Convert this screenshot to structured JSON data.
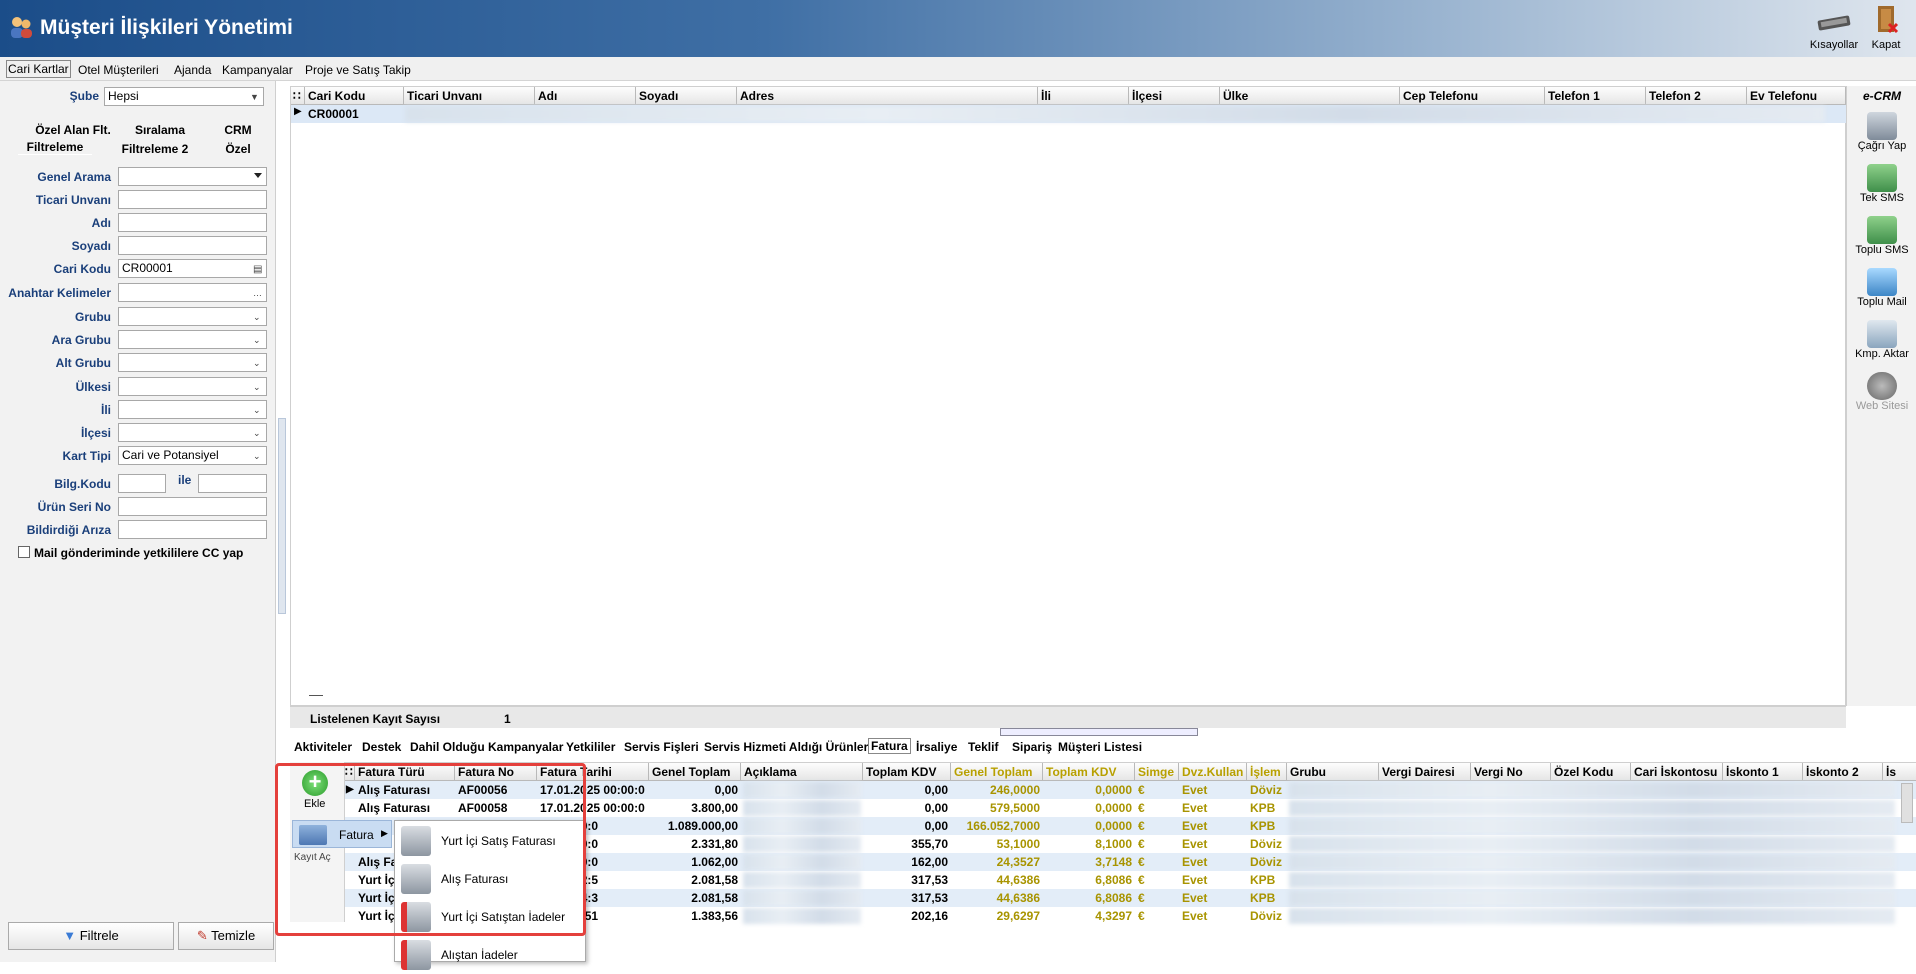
{
  "window": {
    "title": "Müşteri İlişkileri Yönetimi"
  },
  "toolbar": {
    "shortcuts_label": "Kısayollar",
    "close_label": "Kapat"
  },
  "menu": [
    "Cari Kartlar",
    "Otel Müşterileri",
    "Ajanda",
    "Kampanyalar",
    "Proje ve Satış Takip"
  ],
  "filter": {
    "sube_label": "Şube",
    "sube_value": "Hepsi",
    "tabs_row1": [
      "Özel Alan Flt.",
      "Sıralama",
      "CRM"
    ],
    "tabs_row2": [
      "Filtreleme",
      "Filtreleme 2",
      "Özel"
    ],
    "fields": [
      {
        "label": "Genel Arama",
        "value": ""
      },
      {
        "label": "Ticari Unvanı",
        "value": ""
      },
      {
        "label": "Adı",
        "value": ""
      },
      {
        "label": "Soyadı",
        "value": ""
      },
      {
        "label": "Cari Kodu",
        "value": "CR00001"
      },
      {
        "label": "Anahtar Kelimeler",
        "value": ""
      },
      {
        "label": "Grubu",
        "value": ""
      },
      {
        "label": "Ara Grubu",
        "value": ""
      },
      {
        "label": "Alt Grubu",
        "value": ""
      },
      {
        "label": "Ülkesi",
        "value": ""
      },
      {
        "label": "İli",
        "value": ""
      },
      {
        "label": "İlçesi",
        "value": ""
      },
      {
        "label": "Kart Tipi",
        "value": "Cari ve Potansiyel"
      }
    ],
    "bilg_kodu_label": "Bilg.Kodu",
    "ile_label": "ile",
    "urun_seri_label": "Ürün Seri No",
    "bildirdigi_ariza_label": "Bildirdiği Arıza",
    "mail_cc_label": "Mail gönderiminde yetkililere CC yap",
    "filter_button": "Filtrele",
    "clear_button": "Temizle"
  },
  "main_grid": {
    "columns": [
      "Cari Kodu",
      "Ticari Unvanı",
      "Adı",
      "Soyadı",
      "Adres",
      "İli",
      "İlçesi",
      "Ülke",
      "Cep Telefonu",
      "Telefon 1",
      "Telefon 2",
      "Ev Telefonu"
    ],
    "rows": [
      {
        "cari_kodu": "CR00001"
      }
    ],
    "status_label": "Listelenen Kayıt Sayısı",
    "status_count": "1"
  },
  "ecrm": {
    "title": "e-CRM",
    "buttons": [
      "Çağrı Yap",
      "Tek SMS",
      "Toplu SMS",
      "Toplu Mail",
      "Kmp. Aktar",
      "Web Sitesi"
    ]
  },
  "bottom_tabs": [
    "Aktiviteler",
    "Destek",
    "Dahil Olduğu Kampanyalar",
    "Yetkililer",
    "Servis Fişleri",
    "Servis Hizmeti Aldığı Ürünler",
    "Fatura",
    "İrsaliye",
    "Teklif",
    "Sipariş",
    "Müşteri Listesi"
  ],
  "side_actions": {
    "add_label": "Ekle",
    "records_label": "Kayıt Aç"
  },
  "invoice_grid": {
    "columns": [
      "Fatura Türü",
      "Fatura No",
      "Fatura Tarihi",
      "Genel Toplam",
      "Açıklama",
      "Toplam KDV",
      "Genel Toplam",
      "Toplam KDV",
      "Simge",
      "Dvz.Kullan",
      "İşlem",
      "Grubu",
      "Vergi Dairesi",
      "Vergi No",
      "Özel Kodu",
      "Cari İskontosu",
      "İskonto 1",
      "İskonto 2",
      "İs"
    ],
    "rows": [
      {
        "tur": "Alış Faturası",
        "no": "AF00056",
        "tarih": "17.01.2025 00:00:0",
        "genel": "0,00",
        "kdv": "0,00",
        "dgenel": "246,0000",
        "dkdv": "0,0000",
        "simge": "€",
        "dvz": "Evet",
        "islem": "Döviz"
      },
      {
        "tur": "Alış Faturası",
        "no": "AF00058",
        "tarih": "17.01.2025 00:00:0",
        "genel": "3.800,00",
        "kdv": "0,00",
        "dgenel": "579,5000",
        "dkdv": "0,0000",
        "simge": "€",
        "dvz": "Evet",
        "islem": "KPB"
      },
      {
        "tur": "",
        "no": "",
        "tarih": "25 00:00:0",
        "genel": "1.089.000,00",
        "kdv": "0,00",
        "dgenel": "166.052,7000",
        "dkdv": "0,0000",
        "simge": "€",
        "dvz": "Evet",
        "islem": "KPB"
      },
      {
        "tur": "",
        "no": "",
        "tarih": "25 00:00:0",
        "genel": "2.331,80",
        "kdv": "355,70",
        "dgenel": "53,1000",
        "dkdv": "8,1000",
        "simge": "€",
        "dvz": "Evet",
        "islem": "Döviz"
      },
      {
        "tur": "Alış Fa",
        "no": "",
        "tarih": "25 00:00:0",
        "genel": "1.062,00",
        "kdv": "162,00",
        "dgenel": "24,3527",
        "dkdv": "3,7148",
        "simge": "€",
        "dvz": "Evet",
        "islem": "Döviz"
      },
      {
        "tur": "Yurt İç",
        "no": "",
        "tarih": "25 12:32:5",
        "genel": "2.081,58",
        "kdv": "317,53",
        "dgenel": "44,6386",
        "dkdv": "6,8086",
        "simge": "€",
        "dvz": "Evet",
        "islem": "KPB"
      },
      {
        "tur": "Yurt İç",
        "no": "",
        "tarih": "25 12:34:3",
        "genel": "2.081,58",
        "kdv": "317,53",
        "dgenel": "44,6386",
        "dkdv": "6,8086",
        "simge": "€",
        "dvz": "Evet",
        "islem": "KPB"
      },
      {
        "tur": "Yurt İç",
        "no": "",
        "tarih": "5 14:25:51",
        "genel": "1.383,56",
        "kdv": "202,16",
        "dgenel": "29,6297",
        "dkdv": "4,3297",
        "simge": "€",
        "dvz": "Evet",
        "islem": "Döviz"
      }
    ]
  },
  "context_menu": {
    "parent": "Fatura",
    "items": [
      "Yurt İçi Satış Faturası",
      "Alış Faturası",
      "Yurt İçi Satıştan İadeler",
      "Alıştan İadeler"
    ]
  },
  "colors": {
    "accent_olive": "#a89400",
    "highlight": "#e4403c",
    "title_bar": "#1b4d89"
  }
}
